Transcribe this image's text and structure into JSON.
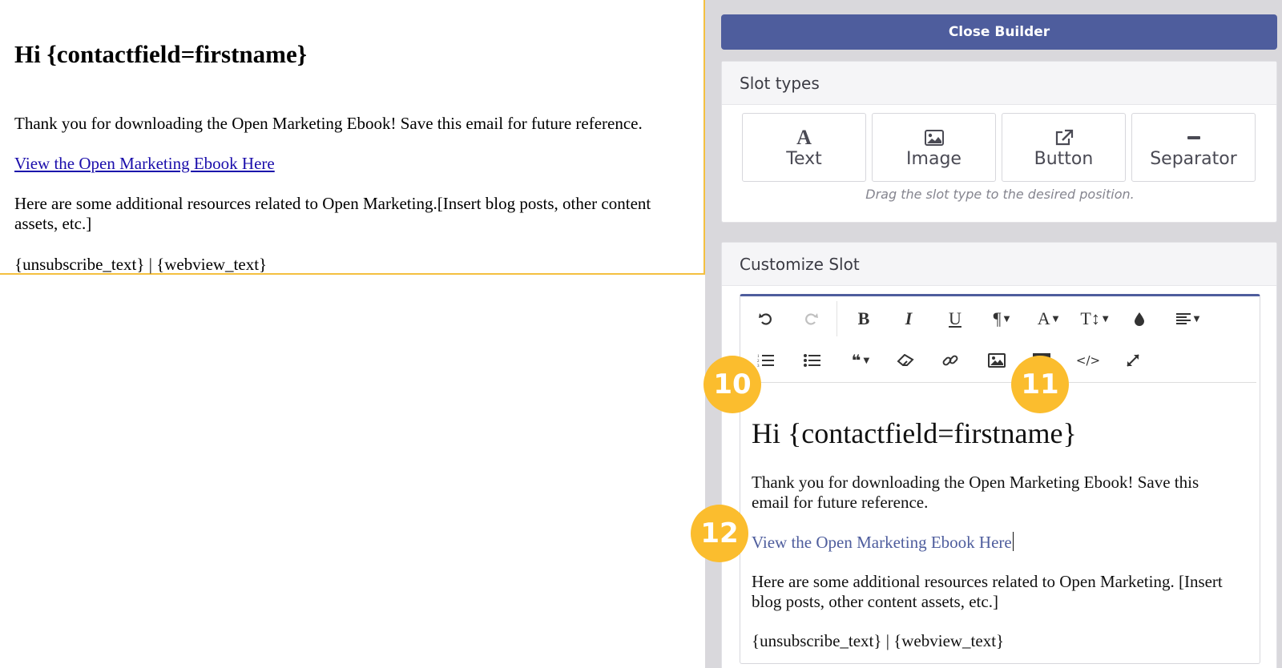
{
  "preview": {
    "heading": "Hi {contactfield=firstname}",
    "para1": "Thank you for downloading the Open Marketing Ebook! Save this email for future reference.",
    "link": "View the Open Marketing Ebook Here",
    "para2": "Here are some additional resources related to Open Marketing.[Insert blog posts, other content assets, etc.]",
    "footer": "{unsubscribe_text} | {webview_text}"
  },
  "builder": {
    "close_label": "Close Builder",
    "slot_types": {
      "title": "Slot types",
      "items": [
        {
          "label": "Text",
          "icon": "text-icon"
        },
        {
          "label": "Image",
          "icon": "image-icon"
        },
        {
          "label": "Button",
          "icon": "external-link-icon"
        },
        {
          "label": "Separator",
          "icon": "separator-icon"
        }
      ],
      "hint": "Drag the slot type to the desired position."
    },
    "customize": {
      "title": "Customize Slot",
      "toolbar_colors": {
        "accent": "#4e5d9d"
      },
      "content": {
        "heading": "Hi {contactfield=firstname}",
        "para1": "Thank you for downloading the Open Marketing Ebook! Save this email for future reference.",
        "link": "View the Open Marketing Ebook Here",
        "para2": "Here are some additional resources related to Open Marketing. [Insert blog posts, other content assets, etc.]",
        "footer": "{unsubscribe_text} | {webview_text}"
      }
    }
  },
  "badges": [
    "10",
    "11",
    "12"
  ],
  "colors": {
    "accent": "#4e5d9d",
    "highlight": "#f4c040",
    "badge": "#fbbd2e",
    "link": "#1a0dab"
  }
}
